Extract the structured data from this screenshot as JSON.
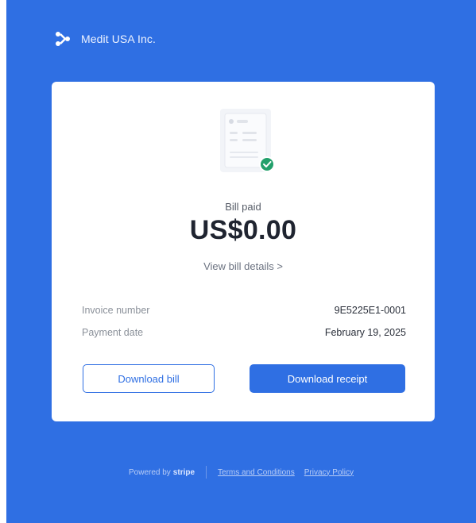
{
  "header": {
    "company_name": "Medit USA Inc."
  },
  "card": {
    "status": "Bill paid",
    "amount": "US$0.00",
    "details_link": "View bill details >",
    "info": [
      {
        "label": "Invoice number",
        "value": "9E5225E1-0001"
      },
      {
        "label": "Payment date",
        "value": "February 19, 2025"
      }
    ],
    "buttons": {
      "download_bill": "Download bill",
      "download_receipt": "Download receipt"
    }
  },
  "footer": {
    "powered_by": "Powered by",
    "brand": "stripe",
    "terms": "Terms and Conditions",
    "privacy": "Privacy Policy"
  },
  "colors": {
    "background": "#2f6fe3",
    "accent": "#2f6fe3",
    "success": "#22a06b"
  }
}
